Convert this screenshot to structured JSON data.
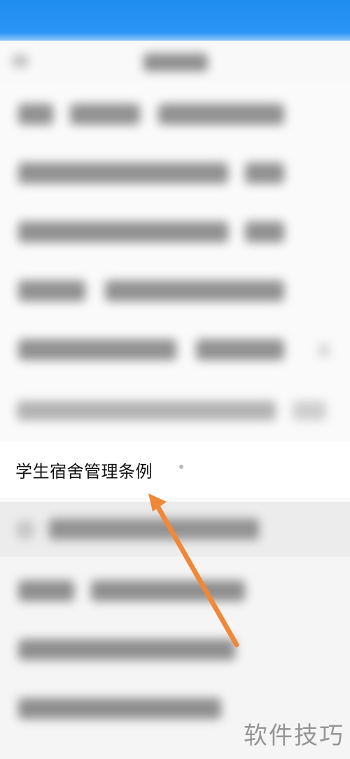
{
  "list": {
    "highlighted_item_label": "学生宿舍管理条例"
  },
  "watermark": {
    "text": "软件技巧"
  },
  "colors": {
    "status_bar": "#1f8cf0",
    "annotation_arrow": "#f0883a"
  },
  "icons": {
    "annotation": "arrow-up-left-icon"
  }
}
